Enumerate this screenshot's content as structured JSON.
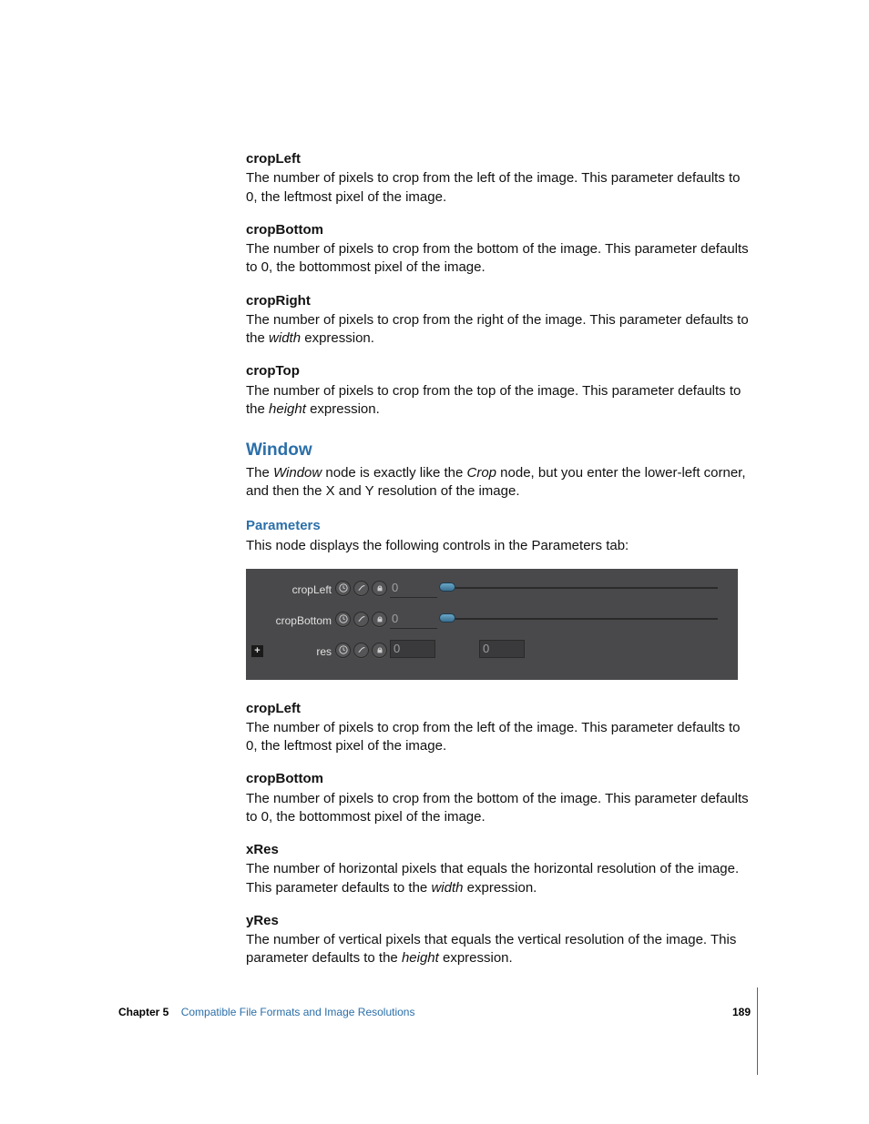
{
  "sections": {
    "cropLeft1": {
      "title": "cropLeft",
      "body_pre": "The number of pixels to crop from the left of the image. This parameter defaults to 0, the leftmost pixel of the image."
    },
    "cropBottom1": {
      "title": "cropBottom",
      "body_pre": "The number of pixels to crop from the bottom of the image. This parameter defaults to 0, the bottommost pixel of the image."
    },
    "cropRight": {
      "title": "cropRight",
      "body_pre": "The number of pixels to crop from the right of the image. This parameter defaults to the ",
      "body_em": "width",
      "body_post": " expression."
    },
    "cropTop": {
      "title": "cropTop",
      "body_pre": "The number of pixels to crop from the top of the image. This parameter defaults to the ",
      "body_em": "height",
      "body_post": " expression."
    },
    "window": {
      "heading": "Window",
      "body_pre": "The ",
      "body_em1": "Window",
      "body_mid": " node is exactly like the ",
      "body_em2": "Crop",
      "body_post": " node, but you enter the lower-left corner, and then the X and Y resolution of the image."
    },
    "parameters": {
      "heading": "Parameters",
      "body": "This node displays the following controls in the Parameters tab:"
    },
    "cropLeft2": {
      "title": "cropLeft",
      "body_pre": "The number of pixels to crop from the left of the image. This parameter defaults to 0, the leftmost pixel of the image."
    },
    "cropBottom2": {
      "title": "cropBottom",
      "body_pre": "The number of pixels to crop from the bottom of the image. This parameter defaults to 0, the bottommost pixel of the image."
    },
    "xRes": {
      "title": "xRes",
      "body_pre": "The number of horizontal pixels that equals the horizontal resolution of the image. This parameter defaults to the ",
      "body_em": "width",
      "body_post": " expression."
    },
    "yRes": {
      "title": "yRes",
      "body_pre": "The number of vertical pixels that equals the vertical resolution of the image. This parameter defaults to the ",
      "body_em": "height",
      "body_post": " expression."
    }
  },
  "panel": {
    "row1": {
      "label": "cropLeft",
      "value": "0"
    },
    "row2": {
      "label": "cropBottom",
      "value": "0"
    },
    "row3": {
      "label": "res",
      "value1": "0",
      "value2": "0",
      "plus": "+"
    }
  },
  "footer": {
    "chapter": "Chapter 5",
    "title": "Compatible File Formats and Image Resolutions",
    "page": "189"
  }
}
